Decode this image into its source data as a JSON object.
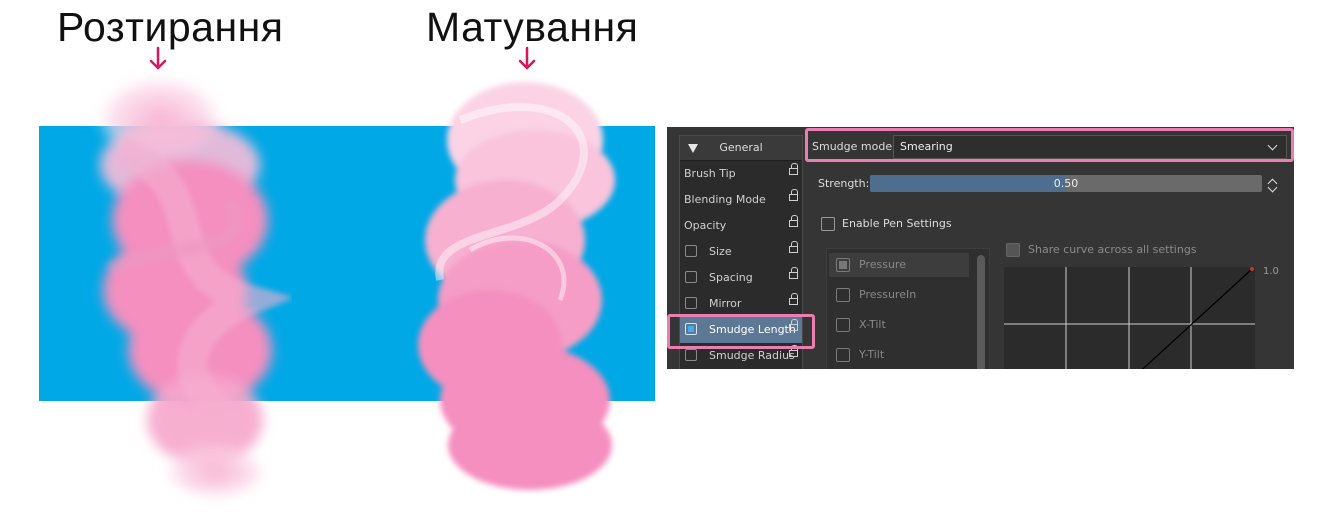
{
  "captions": {
    "left": "Розтирання",
    "right": "Матування"
  },
  "colors": {
    "background_blue": "#00a8e6",
    "paint_pink": "#f48fbf",
    "highlight": "#e87fb0",
    "arrow": "#d4175f"
  },
  "panel": {
    "options_header": "General",
    "options": [
      {
        "label": "Brush Tip",
        "checkbox": false,
        "checked": false
      },
      {
        "label": "Blending Mode",
        "checkbox": false,
        "checked": false
      },
      {
        "label": "Opacity",
        "checkbox": false,
        "checked": false
      },
      {
        "label": "Size",
        "checkbox": true,
        "checked": false
      },
      {
        "label": "Spacing",
        "checkbox": true,
        "checked": false
      },
      {
        "label": "Mirror",
        "checkbox": true,
        "checked": false
      },
      {
        "label": "Smudge Length",
        "checkbox": true,
        "checked": true,
        "selected": true
      },
      {
        "label": "Smudge Radius",
        "checkbox": true,
        "checked": false
      }
    ],
    "smudge_mode_label": "Smudge mode:",
    "smudge_mode_value": "Smearing",
    "strength_label": "Strength:",
    "strength_value": "0.50",
    "strength_fraction": 0.5,
    "enable_pen_label": "Enable Pen Settings",
    "share_curve_label": "Share curve across all settings",
    "sensors": [
      "Pressure",
      "PressureIn",
      "X-Tilt",
      "Y-Tilt"
    ],
    "curve_max_label": "1.0"
  }
}
